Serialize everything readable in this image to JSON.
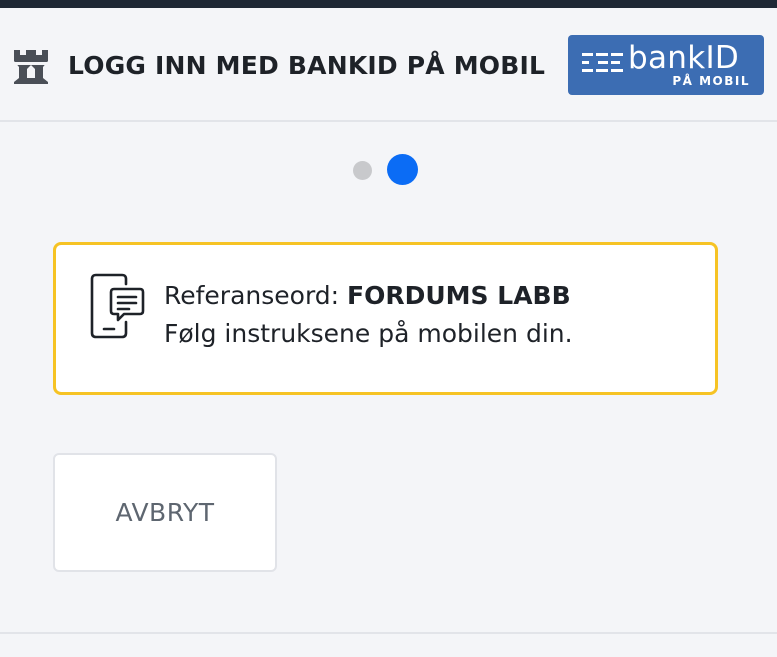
{
  "header": {
    "title": "LOGG INN MED BANKID PÅ MOBIL",
    "icon": "castle-icon",
    "logo": {
      "word": "bankID",
      "subtitle": "PÅ MOBIL",
      "color": "#3c6db3"
    }
  },
  "steps": {
    "total": 2,
    "current": 2,
    "active_color": "#0b6cf5",
    "inactive_color": "#c8c9cc"
  },
  "info": {
    "icon": "phone-chat-icon",
    "reference_label": "Referanseord:",
    "reference_word": "FORDUMS LABB",
    "instruction": "Følg instruksene på mobilen din.",
    "border_color": "#f6c324"
  },
  "actions": {
    "cancel_label": "AVBRYT"
  }
}
